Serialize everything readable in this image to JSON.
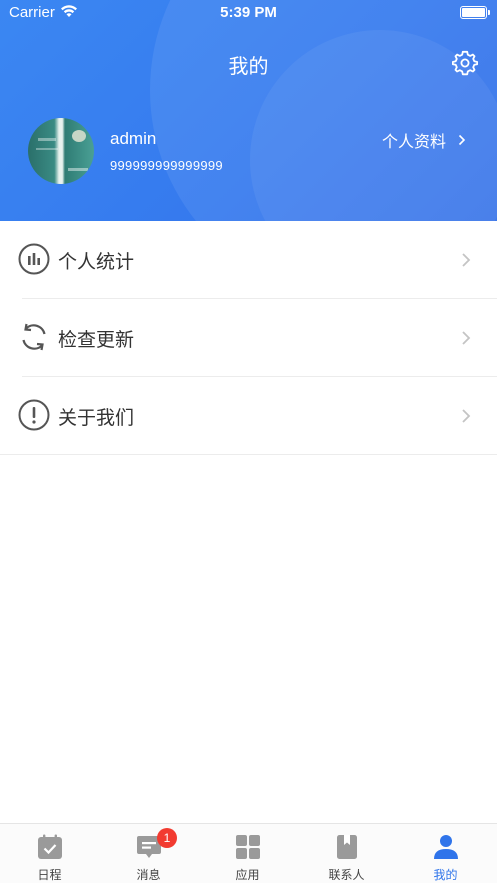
{
  "status_bar": {
    "carrier": "Carrier",
    "time": "5:39 PM"
  },
  "header": {
    "title": "我的",
    "username": "admin",
    "user_id": "999999999999999",
    "profile_link": "个人资料"
  },
  "menu": [
    {
      "label": "个人统计",
      "icon": "bar-chart-circle-icon"
    },
    {
      "label": "检查更新",
      "icon": "refresh-icon"
    },
    {
      "label": "关于我们",
      "icon": "info-exclamation-icon"
    }
  ],
  "tabbar": {
    "tabs": [
      {
        "label": "日程",
        "icon": "calendar-check-icon"
      },
      {
        "label": "消息",
        "icon": "message-icon",
        "badge": "1"
      },
      {
        "label": "应用",
        "icon": "apps-grid-icon"
      },
      {
        "label": "联系人",
        "icon": "contacts-book-icon"
      },
      {
        "label": "我的",
        "icon": "person-icon",
        "active": true
      }
    ]
  },
  "colors": {
    "header_blue": "#3579ee",
    "active_tab": "#2f74ea",
    "badge_red": "#f23b30"
  }
}
